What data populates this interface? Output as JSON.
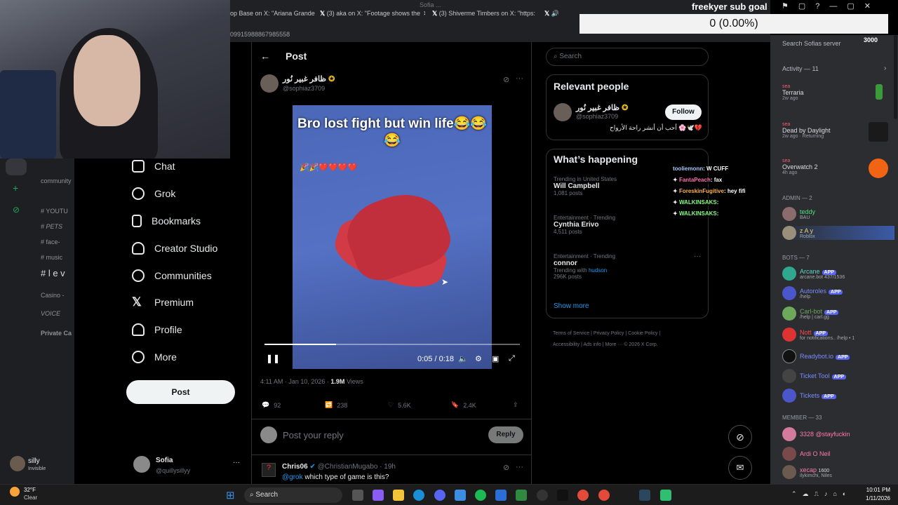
{
  "browser": {
    "tabs": [
      {
        "label": "op Base on X: \"Ariana Grande"
      },
      {
        "label": "(3) aka on X: \"Footage shows the"
      },
      {
        "label": "(3) Shiverme Timbers on X: \"https:"
      }
    ],
    "url": "09915988867985558",
    "window_title": "Sofia ..."
  },
  "overlay": {
    "subgoal_title": "freekyer sub goal",
    "subgoal_value": "0 (0.00%)",
    "days_label": "3000"
  },
  "discord_left": {
    "channels": [
      "community",
      "YOUTU",
      "PETS",
      "face-",
      "music",
      "l e v",
      "Casino -",
      "VOICE",
      "Private Ca"
    ],
    "user_name": "silly",
    "user_status": "Invisible"
  },
  "x_sidebar": {
    "nav": [
      "Chat",
      "Grok",
      "Bookmarks",
      "Creator Studio",
      "Communities",
      "Premium",
      "Profile",
      "More"
    ],
    "post_button": "Post",
    "account_name": "Sofia",
    "account_handle": "@quillysillyy"
  },
  "post": {
    "header": "Post",
    "author_name": "ظافر غبير نُور",
    "author_handle": "@sophiaz3709",
    "video_caption": "Bro lost fight but win life😂😂😂",
    "video_hearts": "🎉🎉❤️❤️❤️❤️",
    "time": "0:05 / 0:18",
    "progress": 0.28,
    "timestamp": "4:11 AM · Jan 10, 2026 ·",
    "views_count": "1.9M",
    "views_label": "Views",
    "replies": "92",
    "reposts": "238",
    "likes": "5.6K",
    "bookmarks": "2.4K",
    "reply_placeholder": "Post your reply",
    "reply_button": "Reply",
    "comment_author": "Chris06",
    "comment_handle": "@ChristianMugabo · 19h",
    "comment_mention": "@grok",
    "comment_text": "which type of game is this?"
  },
  "right_column": {
    "search_placeholder": "Search",
    "relevant_title": "Relevant people",
    "relevant_name": "ظافر غبير نُور",
    "relevant_handle": "@sophiaz3709",
    "relevant_bio": "أحب أن أنشر راحة الأرواح 🌸🕊️💔",
    "follow_button": "Follow",
    "happening_title": "What’s happening",
    "trends": [
      {
        "context": "Trending in United States",
        "title": "Will Campbell",
        "posts": "1,081 posts"
      },
      {
        "context": "Entertainment · Trending",
        "title": "Cynthia Erivo",
        "posts": "4,511 posts"
      },
      {
        "context": "Entertainment · Trending",
        "title": "connor",
        "extra_prefix": "Trending with",
        "extra_link": "hudson",
        "posts": "296K posts"
      }
    ],
    "show_more": "Show more",
    "footer": [
      "Terms of Service",
      "Privacy Policy",
      "Cookie Policy",
      "Accessibility",
      "Ads info",
      "More ···",
      "© 2026 X Corp."
    ]
  },
  "stream_chat": [
    {
      "user": "tooliemonn",
      "msg": ": W CUFF",
      "color": "#a8c8ff"
    },
    {
      "user": "FantaPeach",
      "msg": ": fax",
      "color": "#ff6fb1"
    },
    {
      "user": "ForeskinFugitive",
      "msg": ": hey fifi",
      "color": "#ffb347"
    },
    {
      "user": "WALKINSAKS",
      "msg": ":",
      "color": "#7fff7f"
    },
    {
      "user": "WALKINSAKS",
      "msg": ":",
      "color": "#7fff7f"
    }
  ],
  "discord_right": {
    "search": "Search Sofias server",
    "activity_header": "Activity — 11",
    "activities": [
      {
        "user": "sea",
        "game": "Terraria",
        "time": "2w ago"
      },
      {
        "user": "sea",
        "game": "Dead by Daylight",
        "time": "2w ago · Returning"
      },
      {
        "user": "sea",
        "game": "Overwatch 2",
        "time": "4h ago"
      }
    ],
    "admin_header": "ADMIN — 2",
    "admins": [
      {
        "name": "teddy",
        "sub": "BAU",
        "color": "#4fe07a"
      },
      {
        "name": "z A y",
        "sub": "Roblox",
        "color": "#e6d96b"
      }
    ],
    "bots_header": "BOTS — 7",
    "bots": [
      {
        "name": "Arcane",
        "sub": "arcane.bot 437/1536",
        "color": "#5fd4c7"
      },
      {
        "name": "Autoroles",
        "sub": "/help",
        "color": "#7b8cff"
      },
      {
        "name": "Carl-bot",
        "sub": "/help | carl.gg",
        "color": "#6ea85a"
      },
      {
        "name": "Nott",
        "sub": "for notifications.. /help • 1",
        "color": "#ff4a4a"
      },
      {
        "name": "Readybot.io",
        "sub": "",
        "color": "#7b8cff"
      },
      {
        "name": "Ticket Tool",
        "sub": "",
        "color": "#7b8cff"
      },
      {
        "name": "Tickets",
        "sub": "",
        "color": "#7b8cff"
      }
    ],
    "app_badge": "APP",
    "member_header": "MEMBER — 33",
    "members": [
      {
        "name": "3328 @stayfuckin",
        "sub": "",
        "color": "#ff7aa8"
      },
      {
        "name": "Ardi O Neil",
        "sub": "",
        "color": "#ff7aa8"
      },
      {
        "name": "xecap",
        "sub": "ilykimchi, Niles",
        "color": "#ff7aa8",
        "badge": "1600"
      }
    ]
  },
  "taskbar": {
    "weather_temp": "32°F",
    "weather_desc": "Clear",
    "search": "Search",
    "time": "10:01 PM",
    "date": "1/11/2026"
  }
}
